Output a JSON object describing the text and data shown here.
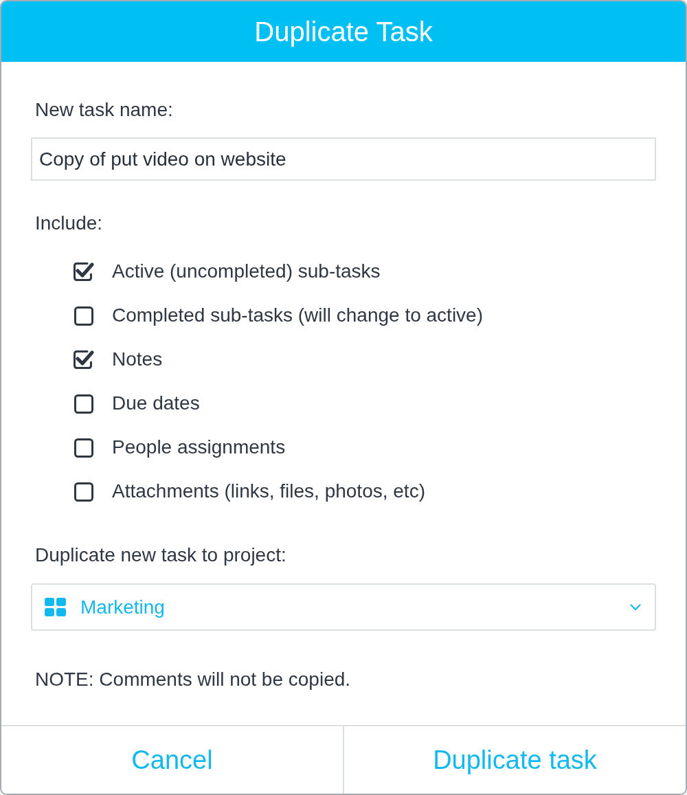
{
  "dialog": {
    "title": "Duplicate Task"
  },
  "name_field": {
    "label": "New task name:",
    "value": "Copy of put video on website"
  },
  "include": {
    "label": "Include:",
    "options": [
      {
        "label": "Active (uncompleted) sub-tasks",
        "checked": true
      },
      {
        "label": "Completed sub-tasks (will change to active)",
        "checked": false
      },
      {
        "label": "Notes",
        "checked": true
      },
      {
        "label": "Due dates",
        "checked": false
      },
      {
        "label": "People assignments",
        "checked": false
      },
      {
        "label": "Attachments (links, files, photos, etc)",
        "checked": false
      }
    ]
  },
  "project": {
    "label": "Duplicate new task to project:",
    "value": "Marketing"
  },
  "note": "NOTE: Comments will not be copied.",
  "buttons": [
    "Cancel",
    "Duplicate task"
  ]
}
